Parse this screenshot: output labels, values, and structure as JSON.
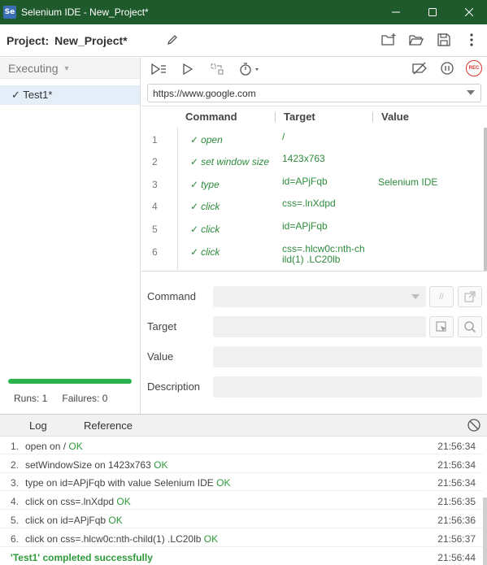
{
  "window": {
    "app_icon_text": "Se",
    "title": "Selenium IDE - New_Project*"
  },
  "project": {
    "label": "Project:",
    "name": "New_Project*"
  },
  "sidebar": {
    "header": "Executing",
    "tests": [
      {
        "label": "✓ Test1*"
      }
    ],
    "runs": "Runs: 1",
    "failures": "Failures: 0",
    "progress": 1.0
  },
  "url": {
    "value": "https://www.google.com"
  },
  "table": {
    "headers": {
      "command": "Command",
      "target": "Target",
      "value": "Value"
    },
    "rows": [
      {
        "index": "1",
        "command": "open",
        "target": "/",
        "value": ""
      },
      {
        "index": "2",
        "command": "set window size",
        "target": "1423x763",
        "value": ""
      },
      {
        "index": "3",
        "command": "type",
        "target": "id=APjFqb",
        "value": "Selenium IDE"
      },
      {
        "index": "4",
        "command": "click",
        "target": "css=.lnXdpd",
        "value": ""
      },
      {
        "index": "5",
        "command": "click",
        "target": "id=APjFqb",
        "value": ""
      },
      {
        "index": "6",
        "command": "click",
        "target": "css=.hlcw0c:nth-child(1) .LC20lb",
        "value": ""
      }
    ],
    "check_glyph": "✓"
  },
  "editor": {
    "command_label": "Command",
    "target_label": "Target",
    "value_label": "Value",
    "description_label": "Description",
    "comment_btn": "//"
  },
  "log": {
    "tab_log": "Log",
    "tab_reference": "Reference",
    "entries": [
      {
        "n": "1.",
        "msg": "open on /",
        "status": "OK",
        "time": "21:56:34"
      },
      {
        "n": "2.",
        "msg": "setWindowSize on 1423x763",
        "status": "OK",
        "time": "21:56:34"
      },
      {
        "n": "3.",
        "msg": "type on id=APjFqb with value Selenium IDE",
        "status": "OK",
        "time": "21:56:34"
      },
      {
        "n": "4.",
        "msg": "click on css=.lnXdpd",
        "status": "OK",
        "time": "21:56:35"
      },
      {
        "n": "5.",
        "msg": "click on id=APjFqb",
        "status": "OK",
        "time": "21:56:36"
      },
      {
        "n": "6.",
        "msg": "click on css=.hlcw0c:nth-child(1) .LC20lb",
        "status": "OK",
        "time": "21:56:37"
      }
    ],
    "final": {
      "msg": "'Test1' completed successfully",
      "time": "21:56:44"
    }
  },
  "colors": {
    "titlebar": "#1f5a2c",
    "pass_green": "#2e8b3d",
    "progress_green": "#2bb24c",
    "record_red": "#d9342b"
  }
}
